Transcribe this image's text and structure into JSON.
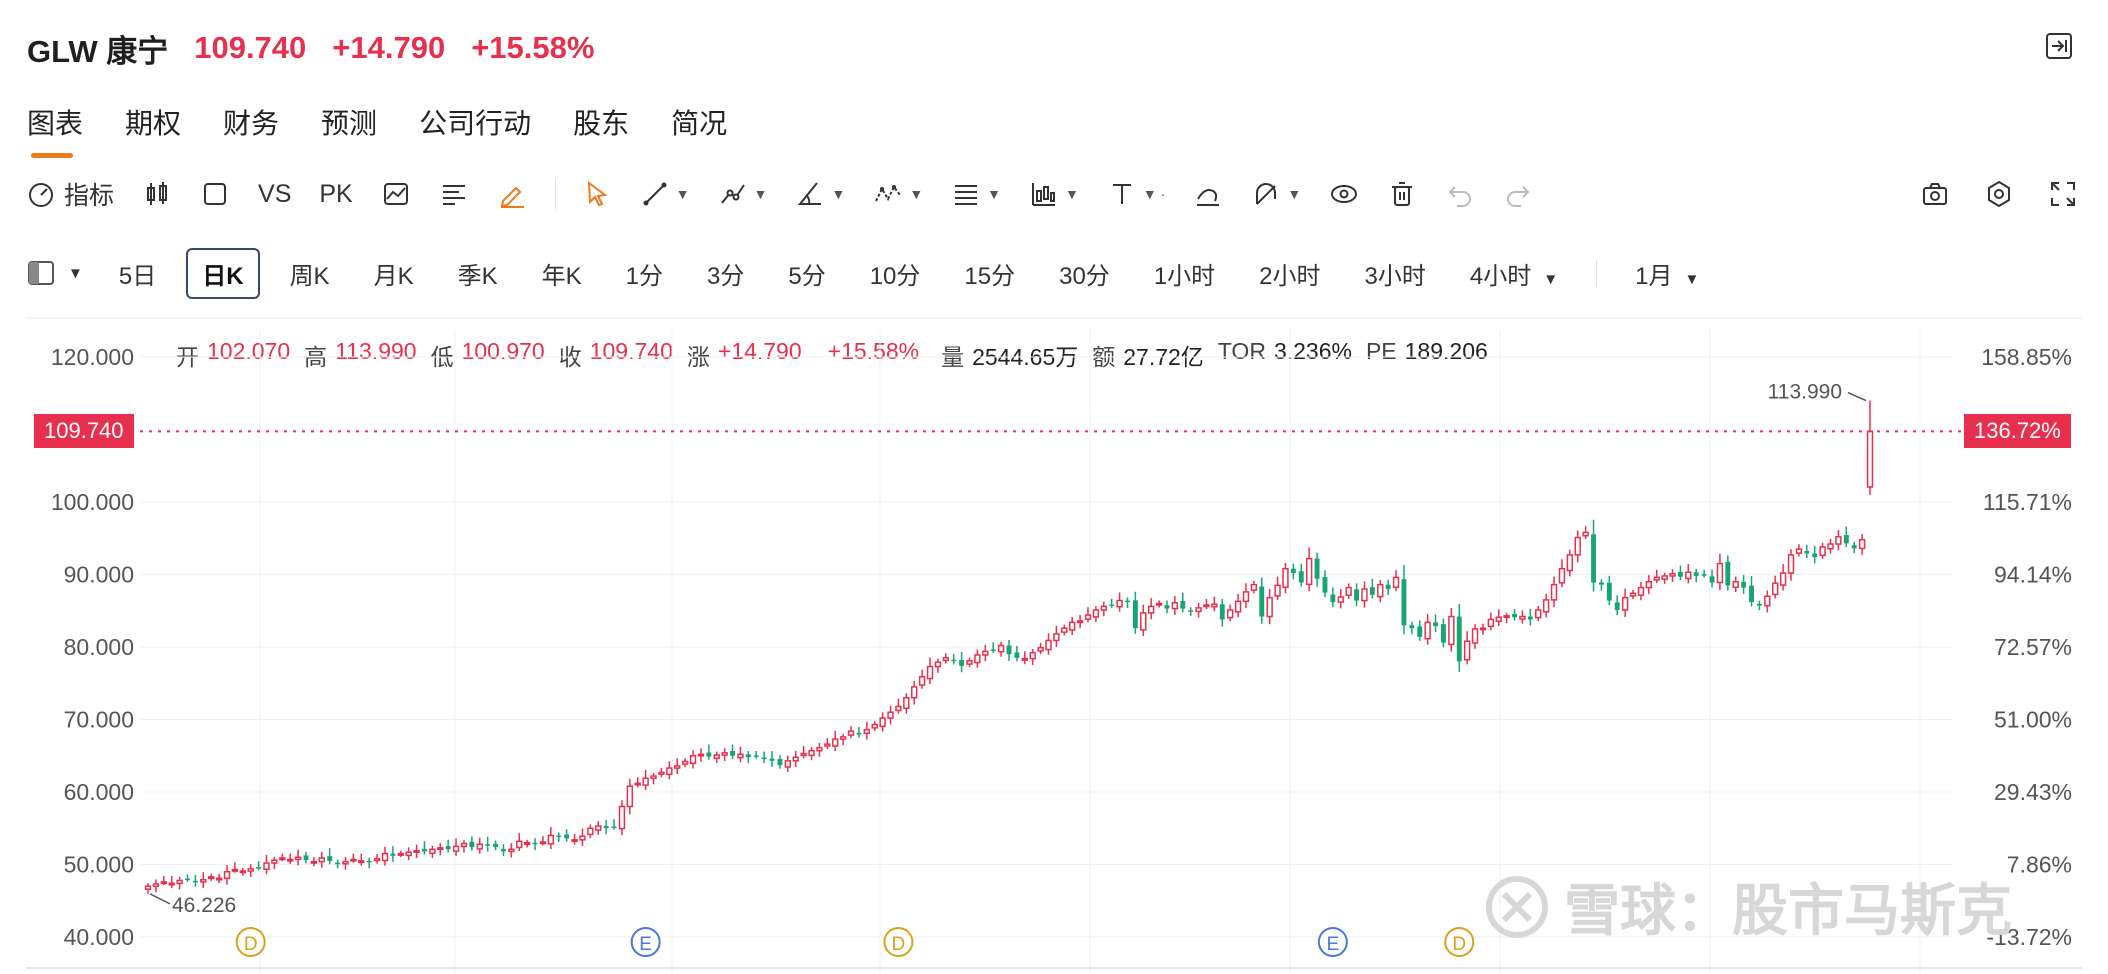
{
  "header": {
    "symbol": "GLW 康宁",
    "price": "109.740",
    "change": "+14.790",
    "change_pct": "+15.58%"
  },
  "tabs": [
    "图表",
    "期权",
    "财务",
    "预测",
    "公司行动",
    "股东",
    "简况"
  ],
  "toolbar": {
    "indicator_label": "指标",
    "vs_label": "VS",
    "pk_label": "PK",
    "icons": [
      "gauge-icon",
      "candlestick-icon",
      "square-icon",
      "area-chart-icon",
      "text-align-icon",
      "pencil-icon",
      "cursor-icon",
      "line-icon",
      "path-icon",
      "angle-icon",
      "wave-icon",
      "fib-icon",
      "pattern-icon",
      "text-icon",
      "measure-icon",
      "magnet-icon",
      "eye-icon",
      "trash-icon",
      "undo-icon",
      "redo-icon",
      "camera-icon",
      "gear-icon",
      "fullscreen-icon"
    ]
  },
  "periods": [
    "5日",
    "日K",
    "周K",
    "月K",
    "季K",
    "年K",
    "1分",
    "3分",
    "5分",
    "10分",
    "15分",
    "30分",
    "1小时",
    "2小时",
    "3小时",
    "4小时"
  ],
  "active_period": "日K",
  "range_label": "1月",
  "ohlc": {
    "open_label": "开",
    "open": "102.070",
    "high_label": "高",
    "high": "113.990",
    "low_label": "低",
    "low": "100.970",
    "close_label": "收",
    "close": "109.740",
    "chg_label": "涨",
    "chg": "+14.790",
    "chg_pct": "+15.58%",
    "vol_label": "量",
    "vol": "2544.65万",
    "amt_label": "额",
    "amt": "27.72亿",
    "tor_label": "TOR",
    "tor": "3.236%",
    "pe_label": "PE",
    "pe": "189.206"
  },
  "price_tag": "109.740",
  "pct_tag": "136.72%",
  "high_label": "113.990",
  "low_label": "46.226",
  "watermark": "雪球：股市马斯克",
  "colors": {
    "up": "#e8304e",
    "down": "#17a673",
    "accent": "#ee7a1b",
    "earnings": "#4a76e0",
    "dividend": "#d9a21b"
  },
  "chart_data": {
    "type": "candlestick",
    "y_ticks": [
      "120.000",
      "100.000",
      "90.000",
      "80.000",
      "70.000",
      "60.000",
      "50.000",
      "40.000"
    ],
    "y_ticks_right": [
      "158.85%",
      "115.71%",
      "94.14%",
      "72.57%",
      "51.00%",
      "29.43%",
      "7.86%",
      "-13.72%"
    ],
    "ylim": [
      40,
      120
    ],
    "markers": [
      {
        "label": "D",
        "index": 13
      },
      {
        "label": "E",
        "index": 63
      },
      {
        "label": "D",
        "index": 95
      },
      {
        "label": "E",
        "index": 150
      },
      {
        "label": "D",
        "index": 166
      }
    ],
    "closes": [
      47.0,
      47.3,
      47.6,
      47.4,
      47.8,
      48.0,
      47.6,
      47.9,
      48.3,
      48.1,
      49.0,
      49.3,
      49.1,
      49.4,
      49.6,
      50.2,
      50.6,
      50.9,
      50.7,
      51.0,
      50.6,
      50.4,
      50.9,
      50.5,
      50.1,
      50.4,
      50.7,
      50.5,
      50.3,
      50.8,
      51.5,
      51.2,
      51.5,
      51.7,
      51.9,
      51.8,
      52.1,
      52.3,
      52.1,
      52.5,
      52.9,
      52.4,
      52.8,
      52.6,
      52.4,
      51.8,
      52.1,
      53.2,
      53.0,
      52.8,
      53.1,
      54.0,
      53.9,
      53.6,
      53.4,
      53.9,
      55.0,
      55.3,
      55.0,
      55.2,
      58.0,
      60.8,
      61.2,
      61.9,
      62.2,
      62.7,
      63.3,
      63.6,
      64.2,
      65.0,
      65.2,
      64.9,
      65.1,
      65.4,
      65.0,
      65.2,
      64.8,
      65.0,
      64.6,
      64.3,
      63.7,
      64.3,
      64.8,
      65.3,
      65.7,
      66.1,
      66.6,
      67.3,
      67.6,
      68.4,
      68.1,
      68.6,
      69.3,
      70.2,
      71.0,
      71.8,
      73.0,
      74.5,
      75.9,
      77.3,
      77.9,
      78.5,
      78.2,
      77.4,
      78.1,
      78.9,
      79.4,
      79.6,
      80.2,
      79.0,
      78.5,
      78.4,
      79.2,
      79.9,
      80.9,
      81.8,
      82.6,
      83.4,
      83.6,
      84.4,
      85.1,
      85.6,
      85.8,
      86.4,
      86.2,
      82.6,
      84.7,
      85.6,
      86.0,
      85.3,
      86.1,
      85.3,
      84.9,
      85.4,
      85.8,
      85.9,
      83.8,
      85.1,
      86.3,
      87.6,
      88.6,
      84.2,
      86.8,
      88.5,
      90.8,
      90.2,
      88.9,
      92.2,
      89.4,
      87.5,
      86.2,
      86.9,
      88.2,
      86.4,
      88.0,
      87.2,
      88.6,
      88.0,
      89.6,
      83.0,
      82.6,
      81.4,
      83.4,
      82.9,
      80.6,
      84.2,
      78.0,
      80.8,
      82.5,
      82.6,
      83.8,
      84.1,
      84.3,
      84.1,
      84.2,
      83.8,
      85.1,
      86.5,
      88.6,
      90.8,
      92.7,
      95.1,
      95.8,
      88.9,
      88.6,
      86.4,
      85.1,
      86.8,
      87.4,
      88.2,
      89.0,
      89.6,
      89.8,
      90.1,
      89.7,
      90.3,
      89.8,
      90.0,
      88.9,
      91.5,
      88.5,
      89.0,
      88.2,
      86.2,
      85.7,
      87.0,
      88.8,
      90.2,
      92.7,
      93.5,
      92.9,
      92.4,
      93.8,
      94.2,
      95.2,
      94.3,
      93.6,
      94.8,
      109.74
    ],
    "last": {
      "open": 102.07,
      "high": 113.99,
      "low": 100.97,
      "close": 109.74
    }
  }
}
